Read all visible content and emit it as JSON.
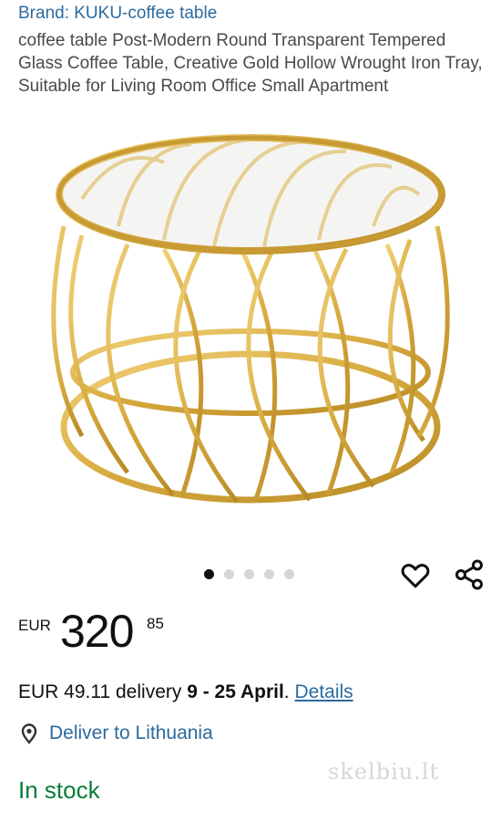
{
  "brand": "Brand: KUKU-coffee table",
  "title": "coffee table Post-Modern Round Transparent Tempered Glass Coffee Table, Creative Gold Hollow Wrought Iron Tray, Suitable for Living Room Office Small Apartment",
  "gallery": {
    "dot_count": 5,
    "active_dot": 0
  },
  "icons": {
    "wishlist": "heart-outline-icon",
    "share": "share-icon",
    "location": "location-pin-icon"
  },
  "price": {
    "currency": "EUR",
    "whole": "320",
    "fraction": "85"
  },
  "delivery": {
    "prefix": "EUR 49.11 delivery ",
    "dates": "9 - 25 April",
    "suffix": ". ",
    "details_link": "Details"
  },
  "location": {
    "label": "Deliver to Lithuania"
  },
  "stock": {
    "status": "In stock"
  },
  "watermark": "skelbiu.lt",
  "colors": {
    "link": "#2b6aa0",
    "in_stock": "#067d36",
    "gold": "#d9b04a"
  }
}
